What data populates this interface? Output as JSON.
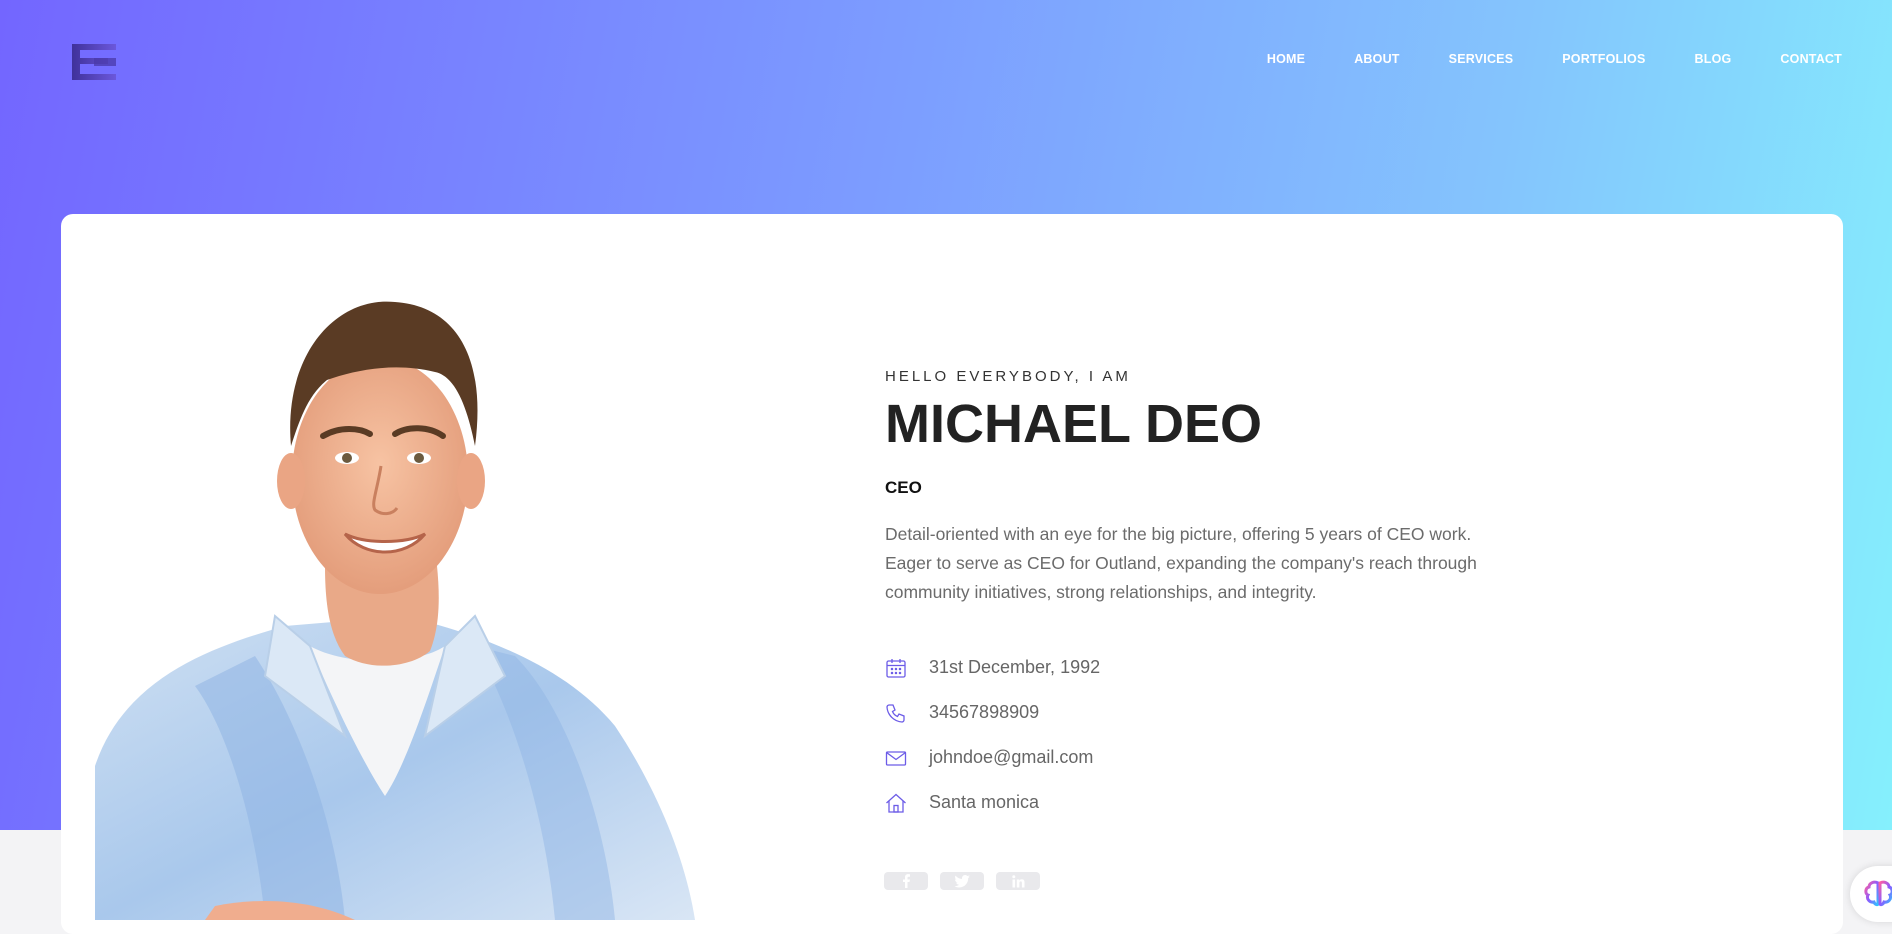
{
  "nav": {
    "items": [
      "HOME",
      "ABOUT",
      "SERVICES",
      "PORTFOLIOS",
      "BLOG",
      "CONTACT"
    ]
  },
  "logo": {
    "icon": "logo-mark"
  },
  "hero": {
    "greeting": "HELLO EVERYBODY, I AM",
    "name": "MICHAEL DEO",
    "role": "CEO",
    "bio": "Detail-oriented with an eye for the big picture, offering 5 years of CEO work. Eager to serve as CEO for Outland, expanding the company's reach through community initiatives, strong relationships, and integrity."
  },
  "info": {
    "birthday": "31st December, 1992",
    "phone": "34567898909",
    "email": "johndoe@gmail.com",
    "address": "Santa monica"
  },
  "socials": [
    "facebook-icon",
    "twitter-icon",
    "linkedin-icon"
  ],
  "colors": {
    "gradient_start": "#7366ff",
    "gradient_end": "#85f0fd",
    "accent": "#6c5ce7"
  }
}
